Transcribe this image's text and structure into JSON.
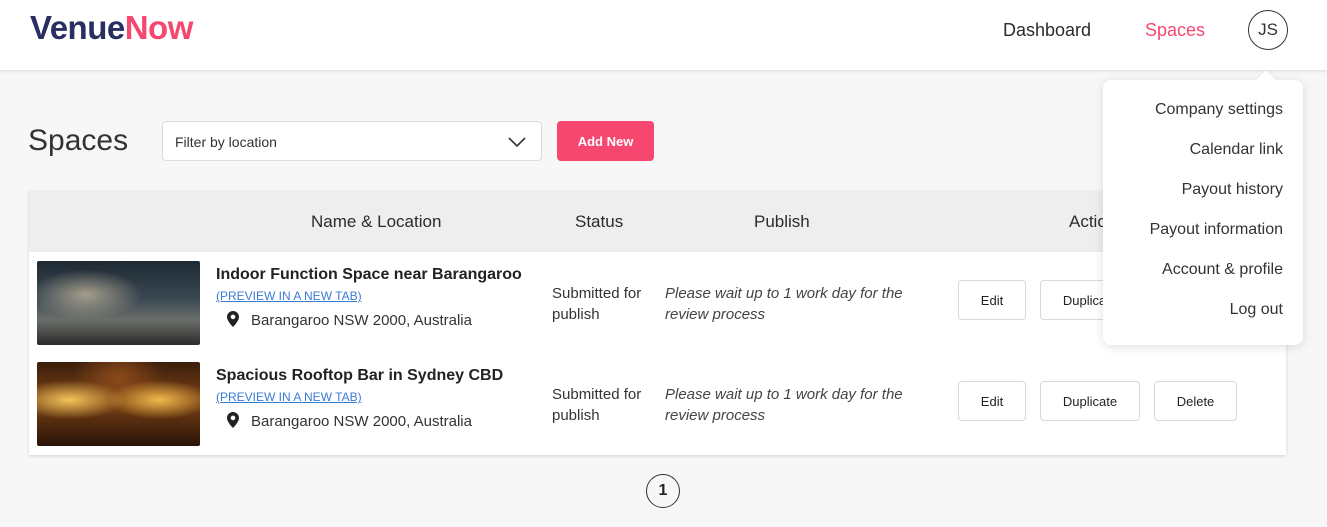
{
  "brand": {
    "part1": "Venue",
    "part2": "Now",
    "color_primary": "#2a2f63",
    "color_accent": "#f5476f"
  },
  "nav": {
    "dashboard": "Dashboard",
    "spaces": "Spaces",
    "avatar_initials": "JS"
  },
  "page": {
    "title": "Spaces"
  },
  "filter": {
    "placeholder": "Filter by location",
    "icon": "chevron-down-icon"
  },
  "add_button": "Add New",
  "table": {
    "headers": {
      "name_location": "Name & Location",
      "status": "Status",
      "publish": "Publish",
      "actions": "Actio"
    },
    "rows": [
      {
        "name": "Indoor Function Space near Barangaroo",
        "preview": "(PREVIEW IN A NEW TAB)",
        "location": "Barangaroo NSW 2000, Australia",
        "status_line1": "Submitted for",
        "status_line2": "publish",
        "publish_line1": "Please wait up to 1 work day for the",
        "publish_line2": "review process",
        "edit": "Edit",
        "duplicate": "Duplicate"
      },
      {
        "name": "Spacious Rooftop Bar in Sydney CBD",
        "preview": "(PREVIEW IN A NEW TAB)",
        "location": "Barangaroo NSW 2000, Australia",
        "status_line1": "Submitted for",
        "status_line2": "publish",
        "publish_line1": "Please wait up to 1 work day for the",
        "publish_line2": "review process",
        "edit": "Edit",
        "duplicate": "Duplicate",
        "delete": "Delete"
      }
    ]
  },
  "pagination": {
    "current_page": "1"
  },
  "user_menu": {
    "items": [
      "Company settings",
      "Calendar link",
      "Payout history",
      "Payout information",
      "Account & profile",
      "Log out"
    ]
  }
}
